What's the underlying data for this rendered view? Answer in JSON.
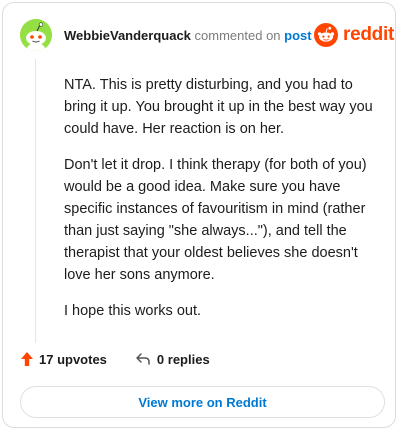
{
  "comment": {
    "author": "WebbieVanderquack",
    "action_text": "commented on",
    "post_link": "post",
    "brand": "reddit",
    "paragraphs": [
      "NTA. This is pretty disturbing, and you had to bring it up. You brought it up in the best way you could have. Her reaction is on her.",
      "Don't let it drop. I think therapy (for both of you) would be a good idea. Make sure you have specific instances of favouritism in mind (rather than just saying \"she always...\"), and tell the therapist that your oldest believes she doesn't love her sons anymore.",
      "I hope this works out."
    ]
  },
  "footer": {
    "upvotes": "17 upvotes",
    "replies": "0 replies"
  },
  "view_more_label": "View more on Reddit",
  "colors": {
    "avatar": "#94e044",
    "brand": "#ff4500",
    "link": "#0079d3",
    "upvote": "#ff4500"
  },
  "icons": {
    "avatar": "snoo-avatar-icon",
    "brand": "reddit-logo-icon",
    "upvote": "upvote-arrow-icon",
    "reply": "reply-arrow-icon"
  }
}
